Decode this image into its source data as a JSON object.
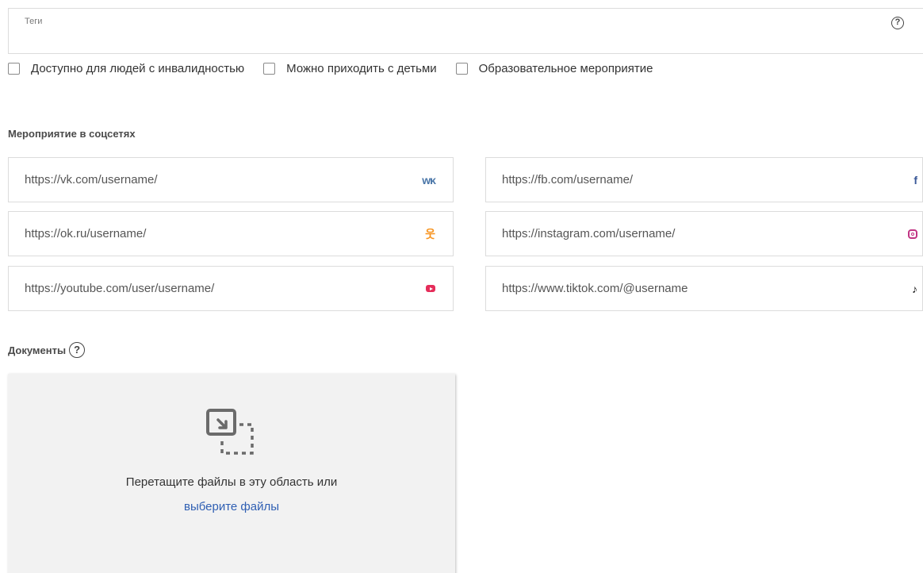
{
  "tags": {
    "label": "Теги",
    "value": ""
  },
  "checkboxes": [
    {
      "label": "Доступно для людей с инвалидностью",
      "checked": false
    },
    {
      "label": "Можно приходить с детьми",
      "checked": false
    },
    {
      "label": "Образовательное мероприятие",
      "checked": false
    }
  ],
  "social": {
    "title": "Мероприятие в соцсетях",
    "fields": [
      {
        "placeholder": "https://vk.com/username/",
        "icon": "vk-icon",
        "value": ""
      },
      {
        "placeholder": "https://fb.com/username/",
        "icon": "facebook-icon",
        "value": ""
      },
      {
        "placeholder": "https://ok.ru/username/",
        "icon": "odnoklassniki-icon",
        "value": ""
      },
      {
        "placeholder": "https://instagram.com/username/",
        "icon": "instagram-icon",
        "value": ""
      },
      {
        "placeholder": "https://youtube.com/user/username/",
        "icon": "youtube-icon",
        "value": ""
      },
      {
        "placeholder": "https://www.tiktok.com/@username",
        "icon": "tiktok-icon",
        "value": ""
      }
    ],
    "icon_glyphs": {
      "vk": "ᴡᴋ",
      "fb": "f",
      "ok": "웃",
      "tt": "♪"
    }
  },
  "documents": {
    "title": "Документы",
    "help_glyph": "?",
    "drop_text": "Перетащите файлы в эту область или",
    "choose_link": "выберите файлы"
  },
  "colors": {
    "link": "#2f5fb3",
    "vk": "#4a76a8",
    "fb": "#3b5998",
    "ok": "#f7931e",
    "youtube": "#e52d5a",
    "instagram": "#c13584",
    "tiktok": "#111111"
  }
}
